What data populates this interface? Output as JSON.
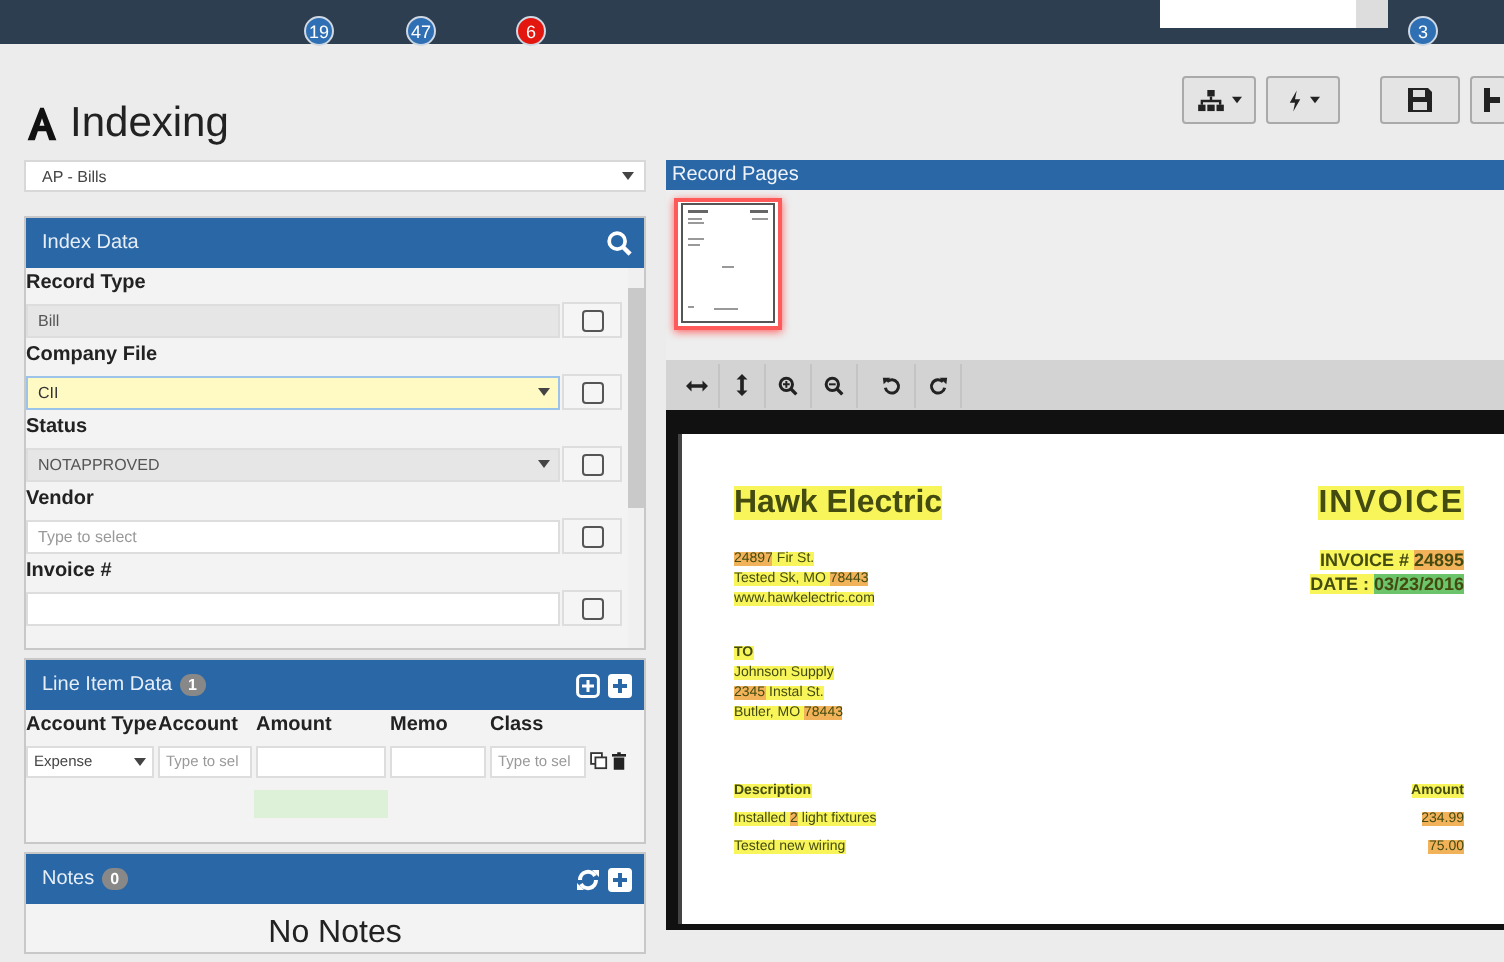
{
  "nav": {
    "badges": [
      {
        "text": "19",
        "color": "#2f6fb3"
      },
      {
        "text": "47",
        "color": "#2f6fb3"
      },
      {
        "text": "6",
        "color": "#e3170f"
      },
      {
        "text": "3",
        "color": "#2f6fb3"
      }
    ]
  },
  "page": {
    "title": "Indexing"
  },
  "document_type": {
    "value": "AP - Bills"
  },
  "index_panel": {
    "title": "Index Data",
    "fields": [
      {
        "label": "Record Type",
        "kind": "text",
        "value": "Bill",
        "disabled": true,
        "focused": false,
        "checked": false
      },
      {
        "label": "Company File",
        "kind": "select",
        "value": "CII",
        "disabled": false,
        "focused": true,
        "checked": false
      },
      {
        "label": "Status",
        "kind": "select",
        "value": "NOTAPPROVED",
        "disabled": true,
        "focused": false,
        "checked": false
      },
      {
        "label": "Vendor",
        "kind": "text",
        "placeholder": "Type to select",
        "disabled": false,
        "focused": false,
        "checked": false
      },
      {
        "label": "Invoice #",
        "kind": "text",
        "disabled": false,
        "focused": false,
        "checked": false
      }
    ]
  },
  "line_items": {
    "title": "Line Item Data",
    "count": "1",
    "columns": [
      "Account Type",
      "Account",
      "Amount",
      "Memo",
      "Class"
    ],
    "rows": [
      {
        "cells": [
          {
            "kind": "select",
            "value": "Expense"
          },
          {
            "kind": "text",
            "placeholder": "Type to sel"
          },
          {
            "kind": "text"
          },
          {
            "kind": "text"
          },
          {
            "kind": "text",
            "placeholder": "Type to sel"
          }
        ]
      }
    ]
  },
  "notes": {
    "title": "Notes",
    "count": "0",
    "empty_text": "No Notes"
  },
  "record_pages": {
    "title": "Record Pages",
    "thumbnails": [
      {
        "selected": true
      }
    ]
  },
  "invoice": {
    "company": [
      {
        "text": "Hawk Electric",
        "color": "#f7f55a"
      }
    ],
    "title": [
      {
        "text": "INVOICE",
        "color": "#f7f55a"
      }
    ],
    "address": [
      [
        {
          "text": "24897",
          "color": "#f2b25a"
        },
        {
          "text": " Fir St.",
          "color": "#f7f55a"
        }
      ],
      [
        {
          "text": "Tested Sk, MO ",
          "color": "#f7f55a"
        },
        {
          "text": "78443",
          "color": "#f2b25a"
        }
      ],
      [
        {
          "text": "www.hawkelectric.com",
          "color": "#f7f55a"
        }
      ]
    ],
    "meta": [
      [
        {
          "text": "INVOICE # ",
          "color": "#f7f55a"
        },
        {
          "text": "24895",
          "color": "#f2b25a"
        }
      ],
      [
        {
          "text": "DATE : ",
          "color": "#f7f55a"
        },
        {
          "text": "03/23/2016",
          "color": "#6cc56a"
        }
      ]
    ],
    "to_label": [
      {
        "text": "TO",
        "color": "#f7f55a"
      }
    ],
    "recipient": [
      [
        {
          "text": "Johnson Supply",
          "color": "#f7f55a"
        }
      ],
      [
        {
          "text": "2345",
          "color": "#f2b25a"
        },
        {
          "text": " Instal St.",
          "color": "#f7f55a"
        }
      ],
      [
        {
          "text": "Butler, MO ",
          "color": "#f7f55a"
        },
        {
          "text": "78443",
          "color": "#f2b25a"
        }
      ]
    ],
    "items_header": {
      "description": [
        {
          "text": "Description",
          "color": "#f7f55a"
        }
      ],
      "amount": [
        {
          "text": "Amount",
          "color": "#f7f55a"
        }
      ]
    },
    "items": [
      {
        "description": [
          {
            "text": "Installed ",
            "color": "#f7f55a"
          },
          {
            "text": "2",
            "color": "#f2b25a"
          },
          {
            "text": " light fixtures",
            "color": "#f7f55a"
          }
        ],
        "amount": [
          {
            "text": "234.99",
            "color": "#f2b25a"
          }
        ]
      },
      {
        "description": [
          {
            "text": "Tested new wiring",
            "color": "#f7f55a"
          }
        ],
        "amount": [
          {
            "text": "75.00",
            "color": "#f2b25a"
          }
        ]
      }
    ]
  }
}
